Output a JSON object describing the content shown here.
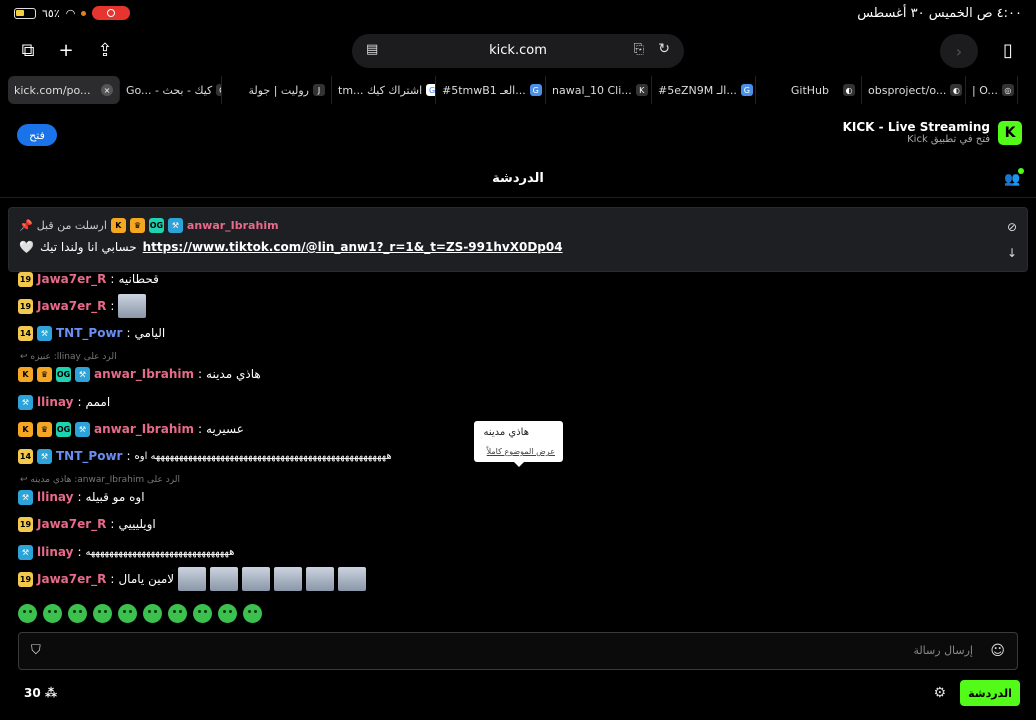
{
  "status": {
    "time": "٤:٠٠ ص  الخميس ٣٠ أغسطس",
    "battery": "٦٥٪"
  },
  "browser": {
    "domain": "kick.com",
    "tabs": [
      {
        "label": "kick.com/po...",
        "fav": "×"
      },
      {
        "label": "Go... - كيك - بحث",
        "fav": "G"
      },
      {
        "label": "روليت | جولة",
        "fav": "J"
      },
      {
        "label": "tm... اشتراك كيك",
        "fav": "G"
      },
      {
        "label": "#5tmwB1 العـ...",
        "fav": "G"
      },
      {
        "label": "nawal_10 Cli...",
        "fav": "K"
      },
      {
        "label": "#5eZN9M الـ...",
        "fav": "G"
      },
      {
        "label": "GitHub",
        "fav": "◐"
      },
      {
        "label": "obsproject/o...",
        "fav": "◐"
      },
      {
        "label": "| O...",
        "fav": "◎"
      }
    ]
  },
  "banner": {
    "open_label": "فتح",
    "title": "KICK - Live Streaming",
    "subtitle": "فتح في تطبيق Kick",
    "logo": "K"
  },
  "chat": {
    "title": "الدردشة",
    "pinned": {
      "username": "anwar_Ibrahim",
      "pinned_by": "ارسلت من قبل",
      "link": "https://www.tiktok.com/@lin_anw1?_r=1&_t=ZS-991hvX0Dp04",
      "text": "حسابي انا ولندا تيك"
    },
    "messages": [
      {
        "user": "Jawa7er_R",
        "color": "#e86a8a",
        "badges": [
          "19"
        ],
        "text": "قحطانيه"
      },
      {
        "user": "Jawa7er_R",
        "color": "#e86a8a",
        "badges": [
          "19"
        ],
        "text": ""
      },
      {
        "user": "TNT_Powr",
        "color": "#6a8ff0",
        "badges": [
          "14",
          "mod"
        ],
        "text": "اليامي"
      },
      {
        "reply": "الرد على llinay: عنيزه"
      },
      {
        "user": "anwar_Ibrahim",
        "color": "#e86a8a",
        "badges": [
          "K",
          "crown",
          "OG",
          "mod"
        ],
        "text": "هاذي مدينه"
      },
      {
        "user": "llinay",
        "color": "#e86a8a",
        "badges": [
          "mod"
        ],
        "text": "اممم"
      },
      {
        "user": "anwar_Ibrahim",
        "color": "#e86a8a",
        "badges": [
          "K",
          "crown",
          "OG",
          "mod"
        ],
        "text": "عسيريه"
      },
      {
        "user": "TNT_Powr",
        "color": "#6a8ff0",
        "badges": [
          "14",
          "mod"
        ],
        "text": "هههههههههههههههههههههههههههههههههههههههههههههههههههه اوه"
      },
      {
        "reply": "الرد على anwar_Ibrahim: هاذي مدينه"
      },
      {
        "user": "llinay",
        "color": "#e86a8a",
        "badges": [
          "mod"
        ],
        "text": "اوه مو قبيله"
      },
      {
        "user": "Jawa7er_R",
        "color": "#e86a8a",
        "badges": [
          "19"
        ],
        "text": "اويليييي"
      },
      {
        "user": "llinay",
        "color": "#e86a8a",
        "badges": [
          "mod"
        ],
        "text": "هههههههههههههههههههههههههههههههه"
      },
      {
        "user": "Jawa7er_R",
        "color": "#e86a8a",
        "badges": [
          "19"
        ],
        "text": "لامين يامال"
      }
    ],
    "tooltip": {
      "text": "هاذي مدينه",
      "link": "عرض الموضوع كاملاً"
    },
    "input_placeholder": "إرسال رسالة",
    "viewer_count": "30",
    "send_label": "الدردشة"
  }
}
